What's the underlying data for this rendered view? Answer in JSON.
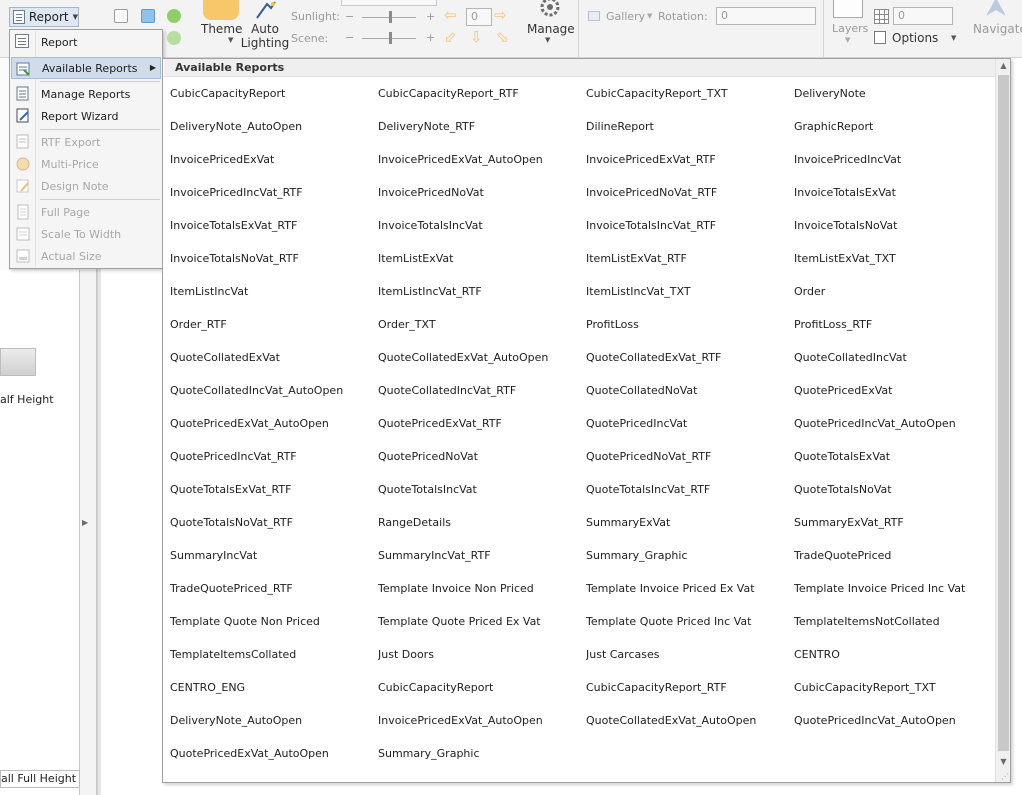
{
  "ribbon": {
    "report_button_label": "Report",
    "theme_label": "Theme",
    "auto_lighting_label": "Auto\nLighting",
    "sunlight_label": "Sunlight:",
    "scene_label": "Scene:",
    "sunlight_value": "0",
    "manage_label": "Manage",
    "gallery_label": "Gallery",
    "rotation_label": "Rotation:",
    "rotation_value": "0",
    "layers_label": "Layers",
    "grid_value": "0",
    "options_label": "Options",
    "navigate_label": "Navigate"
  },
  "left_panel": {
    "half_height_label": "alf Height",
    "full_height_label": "all Full Height"
  },
  "menu": {
    "items": [
      {
        "label": "Report",
        "enabled": true,
        "icon": "report-icon"
      },
      {
        "label": "Available Reports",
        "enabled": true,
        "icon": "available-reports-icon",
        "highlighted": true
      },
      {
        "label": "Manage Reports",
        "enabled": true,
        "icon": "manage-reports-icon"
      },
      {
        "label": "Report Wizard",
        "enabled": true,
        "icon": "report-wizard-icon"
      },
      {
        "label": "RTF Export",
        "enabled": false,
        "icon": "rtf-export-icon"
      },
      {
        "label": "Multi-Price",
        "enabled": false,
        "icon": "multi-price-icon"
      },
      {
        "label": "Design Note",
        "enabled": false,
        "icon": "design-note-icon"
      },
      {
        "label": "Full Page",
        "enabled": false,
        "icon": "full-page-icon"
      },
      {
        "label": "Scale To Width",
        "enabled": false,
        "icon": "scale-to-width-icon"
      },
      {
        "label": "Actual Size",
        "enabled": false,
        "icon": "actual-size-icon"
      }
    ]
  },
  "available_reports": {
    "title": "Available Reports",
    "items": [
      "CubicCapacityReport",
      "CubicCapacityReport_RTF",
      "CubicCapacityReport_TXT",
      "DeliveryNote",
      "DeliveryNote_AutoOpen",
      "DeliveryNote_RTF",
      "DilineReport",
      "GraphicReport",
      "InvoicePricedExVat",
      "InvoicePricedExVat_AutoOpen",
      "InvoicePricedExVat_RTF",
      "InvoicePricedIncVat",
      "InvoicePricedIncVat_RTF",
      "InvoicePricedNoVat",
      "InvoicePricedNoVat_RTF",
      "InvoiceTotalsExVat",
      "InvoiceTotalsExVat_RTF",
      "InvoiceTotalsIncVat",
      "InvoiceTotalsIncVat_RTF",
      "InvoiceTotalsNoVat",
      "InvoiceTotalsNoVat_RTF",
      "ItemListExVat",
      "ItemListExVat_RTF",
      "ItemListExVat_TXT",
      "ItemListIncVat",
      "ItemListIncVat_RTF",
      "ItemListIncVat_TXT",
      "Order",
      "Order_RTF",
      "Order_TXT",
      "ProfitLoss",
      "ProfitLoss_RTF",
      "QuoteCollatedExVat",
      "QuoteCollatedExVat_AutoOpen",
      "QuoteCollatedExVat_RTF",
      "QuoteCollatedIncVat",
      "QuoteCollatedIncVat_AutoOpen",
      "QuoteCollatedIncVat_RTF",
      "QuoteCollatedNoVat",
      "QuotePricedExVat",
      "QuotePricedExVat_AutoOpen",
      "QuotePricedExVat_RTF",
      "QuotePricedIncVat",
      "QuotePricedIncVat_AutoOpen",
      "QuotePricedIncVat_RTF",
      "QuotePricedNoVat",
      "QuotePricedNoVat_RTF",
      "QuoteTotalsExVat",
      "QuoteTotalsExVat_RTF",
      "QuoteTotalsIncVat",
      "QuoteTotalsIncVat_RTF",
      "QuoteTotalsNoVat",
      "QuoteTotalsNoVat_RTF",
      "RangeDetails",
      "SummaryExVat",
      "SummaryExVat_RTF",
      "SummaryIncVat",
      "SummaryIncVat_RTF",
      "Summary_Graphic",
      "TradeQuotePriced",
      "TradeQuotePriced_RTF",
      "Template Invoice Non Priced",
      "Template Invoice Priced Ex Vat",
      "Template Invoice Priced Inc Vat",
      "Template Quote Non Priced",
      "Template Quote Priced Ex Vat",
      "Template Quote Priced Inc Vat",
      "TemplateItemsNotCollated",
      "TemplateItemsCollated",
      "Just Doors",
      "Just Carcases",
      "CENTRO",
      "CENTRO_ENG",
      "CubicCapacityReport",
      "CubicCapacityReport_RTF",
      "CubicCapacityReport_TXT",
      "DeliveryNote_AutoOpen",
      "InvoicePricedExVat_AutoOpen",
      "QuoteCollatedExVat_AutoOpen",
      "QuotePricedIncVat_AutoOpen",
      "QuotePricedExVat_AutoOpen",
      "Summary_Graphic"
    ]
  },
  "colors": {
    "menu_highlight": "#d0dcea",
    "disabled_text": "#a7a7a7",
    "accent_blue": "#2e6db4"
  }
}
